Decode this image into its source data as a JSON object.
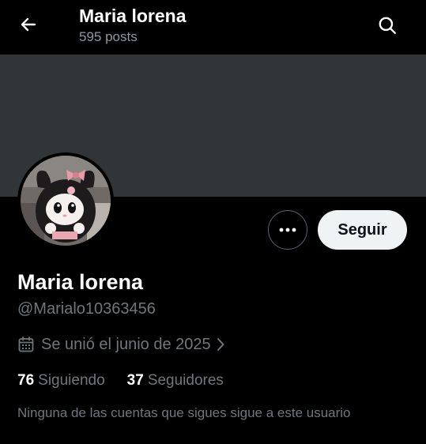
{
  "header": {
    "title": "Maria lorena",
    "posts_count": "595 posts",
    "back_icon": "arrow-left-icon",
    "search_icon": "search-icon"
  },
  "profile": {
    "display_name": "Maria lorena",
    "handle": "@Marialo10363456",
    "joined_text": "Se unió el junio de 2025",
    "avatar_icon": "kuromi-plush-avatar"
  },
  "actions": {
    "follow_label": "Seguir",
    "more_icon": "more-dots-icon"
  },
  "stats": {
    "following_count": "76",
    "following_label": "Siguiendo",
    "followers_count": "37",
    "followers_label": "Seguidores"
  },
  "note": "Ninguna de las cuentas que sigues sigue a este usuario",
  "colors": {
    "background": "#000000",
    "banner": "#323537",
    "secondary_text": "#71767b",
    "follow_button_bg": "#eff3f4"
  }
}
